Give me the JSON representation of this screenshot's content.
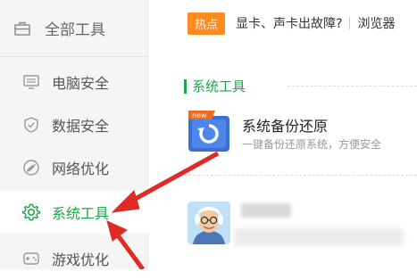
{
  "sidebar": {
    "header": {
      "label": "全部工具",
      "icon": "toolbox-icon"
    },
    "items": [
      {
        "label": "电脑安全",
        "icon": "monitor-icon",
        "active": false
      },
      {
        "label": "数据安全",
        "icon": "shield-check-icon",
        "active": false
      },
      {
        "label": "网络优化",
        "icon": "network-icon",
        "active": false
      },
      {
        "label": "系统工具",
        "icon": "gear-icon",
        "active": true
      },
      {
        "label": "游戏优化",
        "icon": "gamepad-icon",
        "active": false
      }
    ]
  },
  "notice": {
    "badge": "热点",
    "text": "显卡、声卡出故障?",
    "text2": "浏览器"
  },
  "section": {
    "title": "系统工具"
  },
  "tool": {
    "badge": "new",
    "title": "系统备份还原",
    "description": "一键备份还原系统，方便安全"
  },
  "colors": {
    "accent": "#21a54a",
    "hot": "#ff8a1f",
    "arrow": "#e02a25"
  }
}
